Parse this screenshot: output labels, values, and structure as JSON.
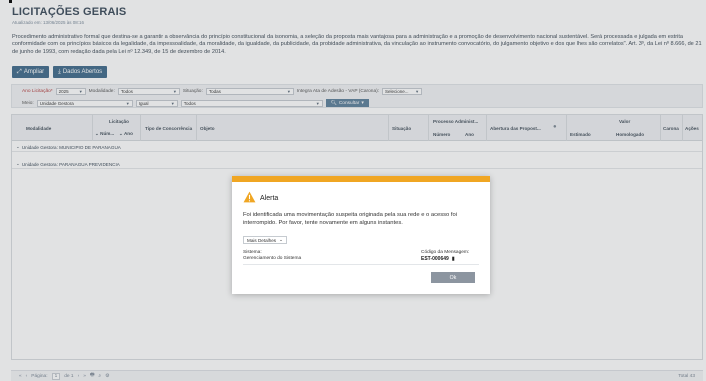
{
  "page": {
    "title": "LICITAÇÕES GERAIS",
    "updated": "Atualizado em: 13/06/2025 às 08:16",
    "description": "Procedimento administrativo formal que destina-se a garantir a observância do princípio constitucional da isonomia, a seleção da proposta mais vantajosa para a administração e a promoção de desenvolvimento nacional sustentável. Será processada e julgada em estrita conformidade com os princípios básicos da legalidade, da impessoalidade, da moralidade, da igualdade, da publicidade, da probidade administrativa, da vinculação ao instrumento convocatório, do julgamento objetivo e dos que lhes são correlatos\". Art. 3º, da Lei nº 8.666, de 21 de junho de 1993, com redação dada pela Lei nº 12.349, de 15 de dezembro de 2014."
  },
  "toolbar": {
    "ampliar": "Ampliar",
    "dados_abertos": "Dados Abertos"
  },
  "filters": {
    "ano_label": "Ano Licitação*",
    "ano_value": "2025",
    "modalidade_label": "Modalidade:",
    "modalidade_value": "Todos",
    "situacao_label": "Situação:",
    "situacao_value": "Todas",
    "integra_label": "Integra Ata de Adesão - VAP (Carona):",
    "integra_value": "Selecione...",
    "meio_label": "Meio:",
    "meio_value": "Unidade Gestora",
    "igual_value": "Igual",
    "todos_value": "Todos",
    "consultar": "Consultar"
  },
  "grid": {
    "headers": {
      "modalidade": "Modalidade",
      "licitacao": "Licitação",
      "num": "Núm...",
      "ano": "Ano",
      "tipo": "Tipo de Concorrência",
      "objeto": "Objeto",
      "situacao": "Situação",
      "processo": "Processo Administ...",
      "numero": "Número",
      "ano2": "Ano",
      "abertura": "Abertura das Propost...",
      "valor": "Valor",
      "estimado": "Estimado",
      "homologado": "Homologado",
      "carona": "Carona",
      "acoes": "Ações"
    },
    "groups": [
      "Unidade Gestora: MUNICIPIO DE PARANAGUA",
      "Unidade Gestora: PARANAGUA PREVIDENCIA"
    ]
  },
  "footer": {
    "pagina_label": "Página:",
    "pagina_value": "1",
    "de": "de 1",
    "total": "Total 43"
  },
  "modal": {
    "title": "Alerta",
    "message": "Foi identificada uma movimentação suspeita originada pela sua rede e o acesso foi interrompido. Por favor, tente novamente em alguns instantes.",
    "more_details": "Mais Detalhes",
    "system_label": "Sistema:",
    "system_value": "Gerenciamento do Sistema",
    "code_label": "Código da Mensagem:",
    "code_value": "EST-000649",
    "ok": "Ok"
  },
  "colors": {
    "primary": "#3f6a8a",
    "warning": "#f0a623",
    "ok_button": "#8c95a0"
  }
}
